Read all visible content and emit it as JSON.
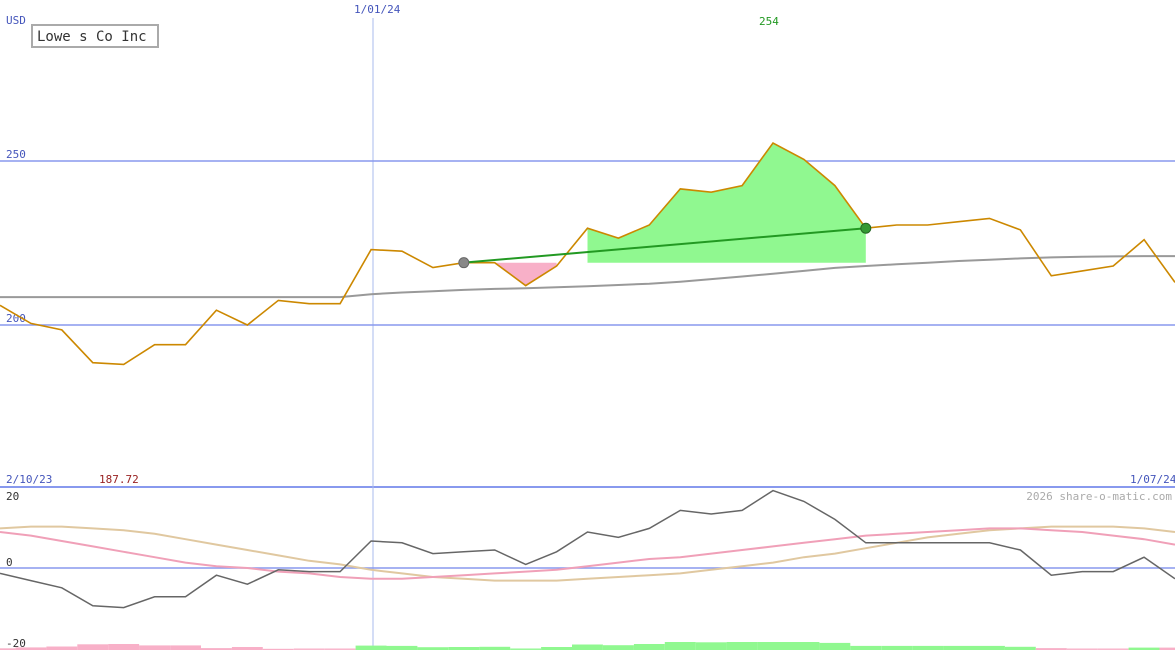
{
  "header": {
    "currency": "USD",
    "title": "Lowe s Co Inc",
    "date_marker": "1/01/24",
    "peak_label": "254"
  },
  "footer": {
    "start_date": "2/10/23",
    "start_value": "187.72",
    "end_date": "1/07/24",
    "watermark": "2026 share-o-matic.com"
  },
  "colors": {
    "price": "#cc8800",
    "moving_average": "#999999",
    "trend": "#229922",
    "gain_fill": "#90f890",
    "loss_fill": "#f8b0c8",
    "gridline": "#8899ee",
    "axis_text": "#4455bb",
    "oscillator": "#666666",
    "osc_pink": "#f0a0b8",
    "osc_tan": "#e0c8a0"
  },
  "chart_data": [
    {
      "type": "line",
      "panel": "price",
      "ylim": [
        170,
        260
      ],
      "yticks": [
        200,
        250
      ],
      "price": [
        206,
        200.5,
        198.5,
        188.5,
        188,
        194,
        194,
        204.5,
        200,
        207.5,
        206.5,
        206.5,
        223,
        222.5,
        217.5,
        219,
        219,
        212,
        218,
        229.5,
        226.5,
        230.5,
        241.5,
        240.5,
        242.5,
        255.5,
        250.5,
        242.5,
        229.5,
        230.5,
        230.5,
        231.5,
        232.5,
        229,
        215,
        216.5,
        218,
        226,
        213
      ],
      "moving_average": [
        208.5,
        208.5,
        208.5,
        208.5,
        208.5,
        208.5,
        208.5,
        208.5,
        208.5,
        208.5,
        208.5,
        208.5,
        209.4,
        209.9,
        210.3,
        210.7,
        211.0,
        211.2,
        211.5,
        211.8,
        212.2,
        212.6,
        213.2,
        214.0,
        214.8,
        215.6,
        216.5,
        217.4,
        218.0,
        218.5,
        219.0,
        219.5,
        219.9,
        220.3,
        220.6,
        220.8,
        220.9,
        221.0,
        221.0
      ],
      "trend": {
        "from_index": 15,
        "from_value": 219,
        "to_index": 28,
        "to_value": 229.5
      },
      "peak": {
        "index": 25,
        "value": 254
      }
    },
    {
      "type": "line",
      "panel": "oscillator",
      "ylim": [
        -20,
        20
      ],
      "yticks": [
        20,
        0,
        -20
      ],
      "osc": [
        -1.5,
        -3.5,
        -5.5,
        -10.5,
        -11,
        -8,
        -8,
        -2,
        -4.5,
        -0.5,
        -1,
        -1,
        7.5,
        7,
        4,
        4.5,
        5,
        1,
        4.5,
        10,
        8.5,
        11,
        16,
        15,
        16,
        21.5,
        18.5,
        13.5,
        7,
        7,
        7,
        7,
        7,
        5,
        -2,
        -1,
        -1,
        3,
        -3
      ],
      "pink": [
        10,
        9,
        7.5,
        6,
        4.5,
        3,
        1.5,
        0.5,
        0,
        -1,
        -1.5,
        -2.5,
        -3,
        -3,
        -2.5,
        -2,
        -1.5,
        -1,
        -0.5,
        0.5,
        1.5,
        2.5,
        3,
        4,
        5,
        6,
        7,
        8,
        9,
        9.5,
        10,
        10.5,
        11,
        11,
        10.5,
        10,
        9,
        8,
        6.5
      ],
      "tan": [
        11,
        11.5,
        11.5,
        11,
        10.5,
        9.5,
        8,
        6.5,
        5,
        3.5,
        2,
        1,
        -0.5,
        -1.5,
        -2.5,
        -3,
        -3.5,
        -3.5,
        -3.5,
        -3,
        -2.5,
        -2,
        -1.5,
        -0.5,
        0.5,
        1.5,
        3,
        4,
        5.5,
        7,
        8.5,
        9.5,
        10.5,
        11,
        11.5,
        11.5,
        11.5,
        11,
        10
      ]
    }
  ]
}
